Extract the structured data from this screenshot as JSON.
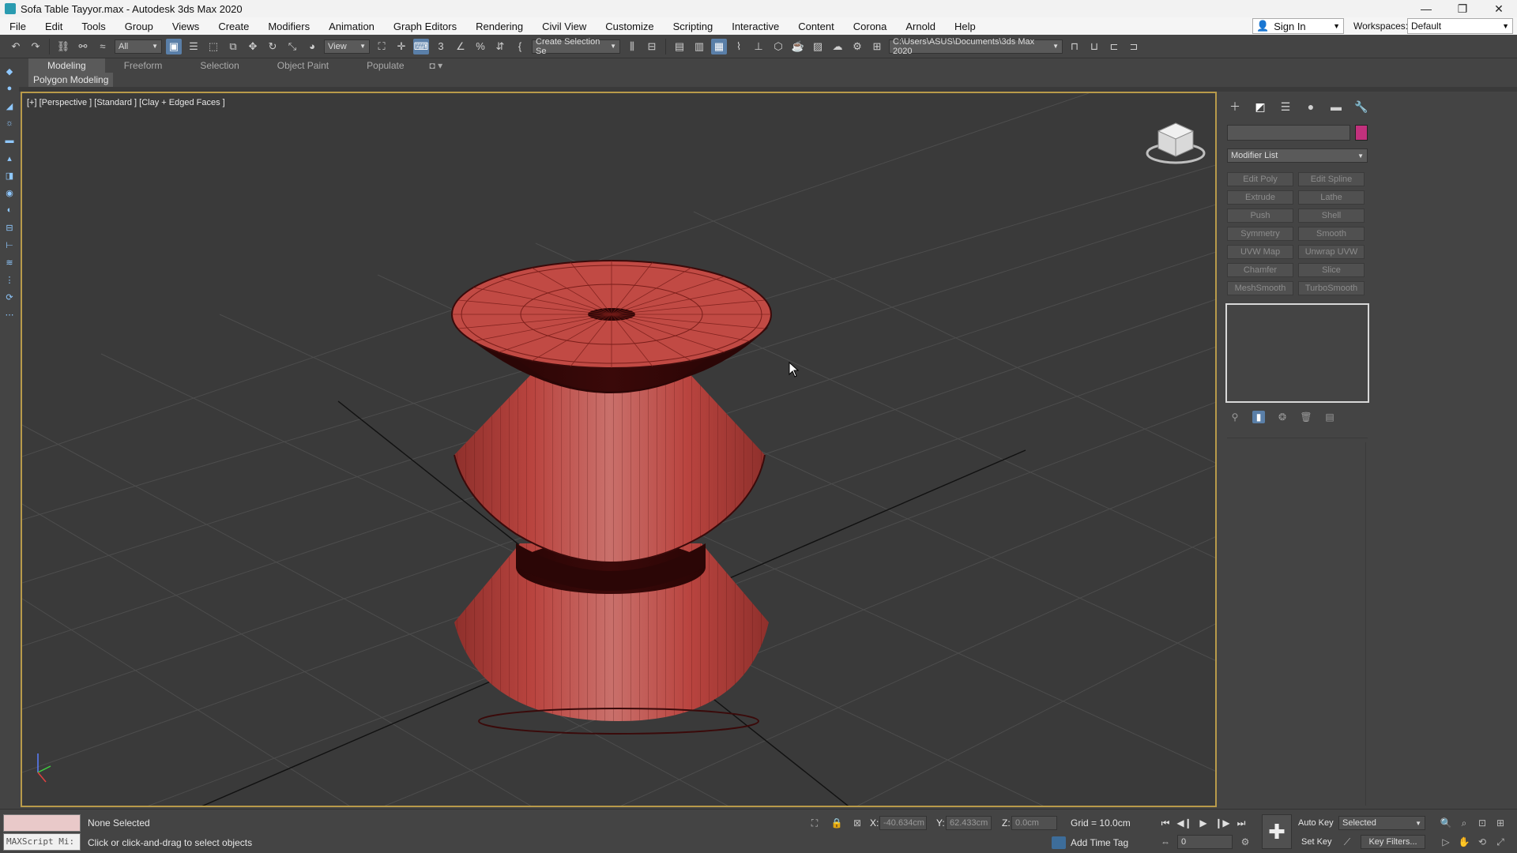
{
  "window": {
    "title": "Sofa Table Tayyor.max - Autodesk 3ds Max 2020",
    "minimize": "—",
    "maximize": "❐",
    "close": "✕"
  },
  "menu": {
    "items": [
      "File",
      "Edit",
      "Tools",
      "Group",
      "Views",
      "Create",
      "Modifiers",
      "Animation",
      "Graph Editors",
      "Rendering",
      "Civil View",
      "Customize",
      "Scripting",
      "Interactive",
      "Content",
      "Corona",
      "Arnold",
      "Help"
    ],
    "sign_in": "Sign In",
    "workspaces_label": "Workspaces:",
    "workspace_value": "Default"
  },
  "toolbar": {
    "selection_filter": "All",
    "ref_coord": "View",
    "named_selection": "Create Selection Se",
    "project_path": "C:\\Users\\ASUS\\Documents\\3ds Max 2020"
  },
  "ribbon": {
    "tabs": [
      "Modeling",
      "Freeform",
      "Selection",
      "Object Paint",
      "Populate"
    ],
    "active_tab": "Modeling",
    "sub_label": "Polygon Modeling"
  },
  "viewport": {
    "label": "[+] [Perspective ] [Standard ] [Clay + Edged Faces ]",
    "object_color": "#c14a44",
    "border_color": "#b89a4a"
  },
  "command_panel": {
    "modifier_list": "Modifier List",
    "object_color": "#c2317d",
    "modifier_buttons": [
      "Edit Poly",
      "Edit Spline",
      "Extrude",
      "Lathe",
      "Push",
      "Shell",
      "Symmetry",
      "Smooth",
      "UVW Map",
      "Unwrap UVW",
      "Chamfer",
      "Slice",
      "MeshSmooth",
      "TurboSmooth"
    ]
  },
  "status": {
    "maxscript_placeholder": "MAXScript Mi:",
    "selection_text": "None Selected",
    "prompt_text": "Click or click-and-drag to select objects",
    "x_label": "X:",
    "x_value": "-40.634cm",
    "y_label": "Y:",
    "y_value": "62.433cm",
    "z_label": "Z:",
    "z_value": "0.0cm",
    "grid": "Grid = 10.0cm",
    "add_time_tag": "Add Time Tag",
    "frame": "0",
    "auto_key": "Auto Key",
    "set_key": "Set Key",
    "selected_dropdown": "Selected",
    "key_filters": "Key Filters..."
  }
}
